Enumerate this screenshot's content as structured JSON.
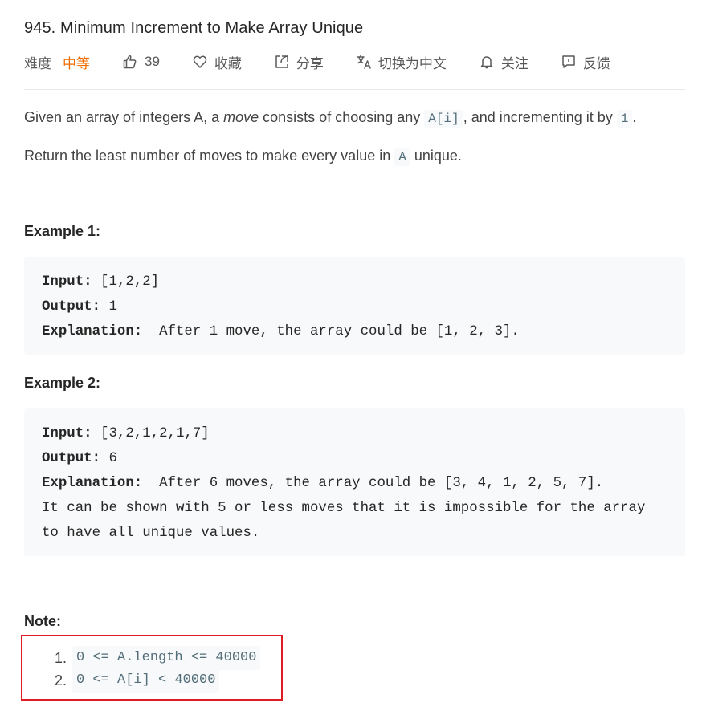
{
  "problem": {
    "title": "945. Minimum Increment to Make Array Unique"
  },
  "toolbar": {
    "difficulty_label": "难度",
    "difficulty_value": "中等",
    "likes": "39",
    "favorite_label": "收藏",
    "share_label": "分享",
    "translate_label": "切换为中文",
    "follow_label": "关注",
    "feedback_label": "反馈",
    "difficulty_color": "#ef6c00"
  },
  "description": {
    "p1_a": "Given an array of integers A, a ",
    "p1_em": "move",
    "p1_b": " consists of choosing any ",
    "p1_code1": "A[i]",
    "p1_c": ", and incrementing it by ",
    "p1_code2": "1",
    "p1_d": ".",
    "p2_a": "Return the least number of moves to make every value in ",
    "p2_code": "A",
    "p2_b": " unique."
  },
  "examples": [
    {
      "heading": "Example 1:",
      "input_label": "Input:",
      "input_value": " [1,2,2]",
      "output_label": "Output:",
      "output_value": " 1",
      "explanation_label": "Explanation:",
      "explanation_value": "  After 1 move, the array could be [1, 2, 3].",
      "extra_lines": []
    },
    {
      "heading": "Example 2:",
      "input_label": "Input:",
      "input_value": " [3,2,1,2,1,7]",
      "output_label": "Output:",
      "output_value": " 6",
      "explanation_label": "Explanation:",
      "explanation_value": "  After 6 moves, the array could be [3, 4, 1, 2, 5, 7].",
      "extra_lines": [
        "It can be shown with 5 or less moves that it is impossible for the array",
        "to have all unique values."
      ]
    }
  ],
  "note": {
    "heading": "Note:",
    "items": [
      {
        "num": "1.",
        "code": "0 <= A.length <= 40000"
      },
      {
        "num": "2.",
        "code": "0 <= A[i] < 40000"
      }
    ],
    "highlight_color": "#e01b24"
  }
}
